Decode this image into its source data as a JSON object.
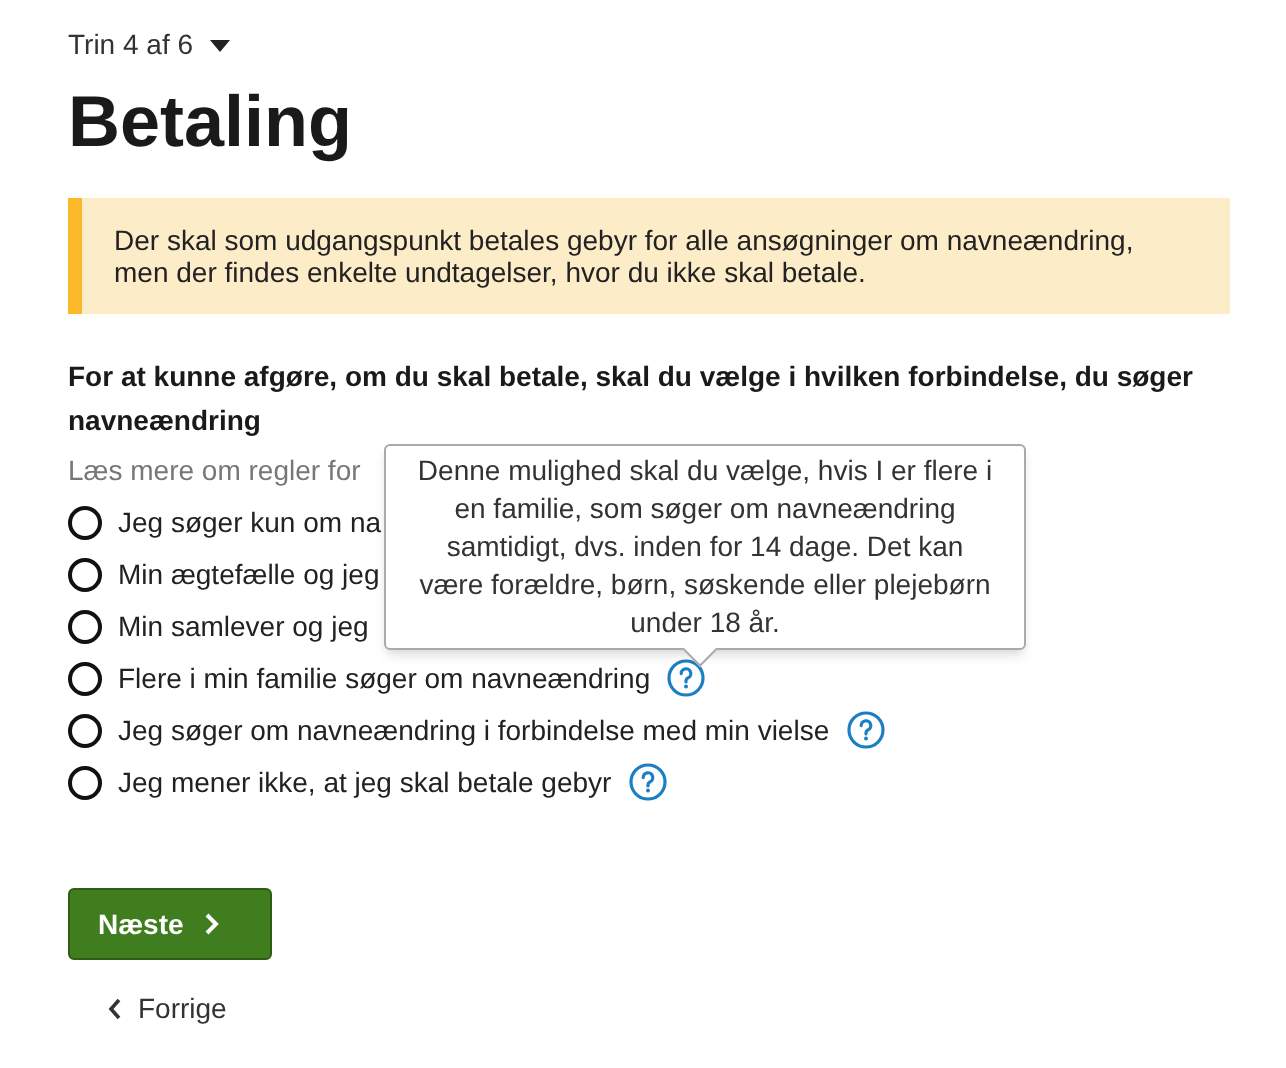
{
  "step": {
    "label": "Trin 4 af 6"
  },
  "title": "Betaling",
  "notice": "Der skal som udgangspunkt betales gebyr for alle ansøgninger om navneændring, men der findes enkelte undtagelser, hvor du ikke skal betale.",
  "question": {
    "label": "For at kunne afgøre, om du skal betale, skal du vælge i hvilken forbindelse, du søger navneændring",
    "hint": "Læs mere om regler for"
  },
  "options": [
    {
      "label": "Jeg søger kun om na",
      "selected": false,
      "help": false
    },
    {
      "label": "Min ægtefælle og jeg",
      "selected": false,
      "help": false
    },
    {
      "label": "Min samlever og jeg",
      "selected": false,
      "help": false
    },
    {
      "label": "Flere i min familie søger om navneændring",
      "selected": false,
      "help": true
    },
    {
      "label": "Jeg søger om navneændring i forbindelse med min vielse",
      "selected": false,
      "help": true
    },
    {
      "label": "Jeg mener ikke, at jeg skal betale gebyr",
      "selected": false,
      "help": true
    }
  ],
  "tooltip": "Denne mulighed skal du vælge, hvis I er flere i en familie, som søger om navneændring samtidigt, dvs. inden for 14 dage. Det kan være forældre, børn, søskende eller plejebørn under 18 år.",
  "buttons": {
    "next": "Næste",
    "back": "Forrige"
  }
}
